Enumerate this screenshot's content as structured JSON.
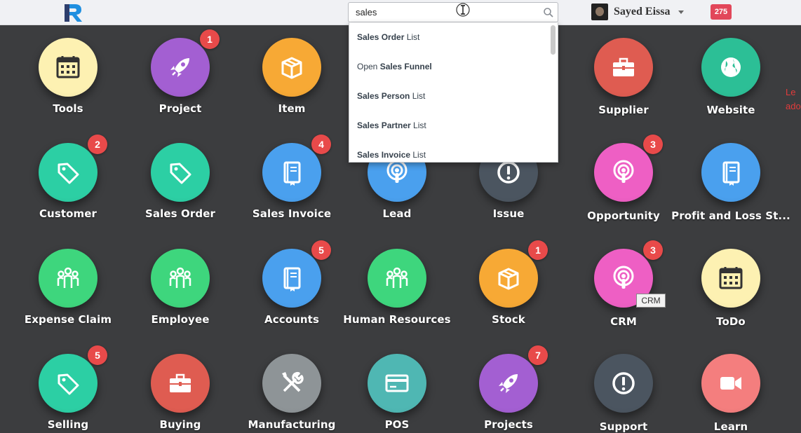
{
  "topbar": {
    "search_value": "sales",
    "user_name": "Sayed Eissa",
    "notification_count": "275"
  },
  "dropdown": [
    {
      "pre": "",
      "bold": "Sales Order",
      "post": " List"
    },
    {
      "pre": "Open ",
      "bold": "Sales Funnel",
      "post": ""
    },
    {
      "pre": "",
      "bold": "Sales Person",
      "post": " List"
    },
    {
      "pre": "",
      "bold": "Sales Partner",
      "post": " List"
    },
    {
      "pre": "",
      "bold": "Sales Invoice",
      "post": " List"
    }
  ],
  "tooltip": "CRM",
  "side_text": [
    "Le",
    "ado"
  ],
  "apps": [
    {
      "label": "Tools",
      "color": "#fdf1b2",
      "icon": "calendar",
      "badge": null
    },
    {
      "label": "Project",
      "color": "#a35fd2",
      "icon": "rocket",
      "badge": "1"
    },
    {
      "label": "Item",
      "color": "#f7a935",
      "icon": "box",
      "badge": null
    },
    {
      "label": "",
      "color": "",
      "icon": "",
      "badge": null
    },
    {
      "label": "",
      "color": "",
      "icon": "",
      "badge": null
    },
    {
      "label": "Supplier",
      "color": "#df5c51",
      "icon": "briefcase",
      "badge": null
    },
    {
      "label": "Website",
      "color": "#2cbf96",
      "icon": "globe",
      "badge": null
    },
    {
      "label": "Customer",
      "color": "#2ccfa4",
      "icon": "tag",
      "badge": "2"
    },
    {
      "label": "Sales Order",
      "color": "#2ccfa4",
      "icon": "tag",
      "badge": null
    },
    {
      "label": "Sales Invoice",
      "color": "#4aa0ee",
      "icon": "book",
      "badge": "4"
    },
    {
      "label": "Lead",
      "color": "#4aa0ee",
      "icon": "podcast",
      "badge": null
    },
    {
      "label": "Issue",
      "color": "#4b5560",
      "icon": "exclaim",
      "badge": null
    },
    {
      "label": "Opportunity",
      "color": "#ee5fc4",
      "icon": "podcast",
      "badge": "3"
    },
    {
      "label": "Profit and Loss St...",
      "color": "#4aa0ee",
      "icon": "book",
      "badge": null
    },
    {
      "label": "Expense Claim",
      "color": "#3ed67d",
      "icon": "people",
      "badge": null
    },
    {
      "label": "Employee",
      "color": "#3ed67d",
      "icon": "people",
      "badge": null
    },
    {
      "label": "Accounts",
      "color": "#4aa0ee",
      "icon": "book",
      "badge": "5"
    },
    {
      "label": "Human Resources",
      "color": "#3ed67d",
      "icon": "people",
      "badge": null
    },
    {
      "label": "Stock",
      "color": "#f7a935",
      "icon": "box",
      "badge": "1"
    },
    {
      "label": "CRM",
      "color": "#ee5fc4",
      "icon": "podcast",
      "badge": "3"
    },
    {
      "label": "ToDo",
      "color": "#fdf1b2",
      "icon": "calendar",
      "badge": null
    },
    {
      "label": "Selling",
      "color": "#2ccfa4",
      "icon": "tag",
      "badge": "5"
    },
    {
      "label": "Buying",
      "color": "#df5c51",
      "icon": "briefcase",
      "badge": null
    },
    {
      "label": "Manufacturing",
      "color": "#8e9497",
      "icon": "tools",
      "badge": null
    },
    {
      "label": "POS",
      "color": "#4fb7b3",
      "icon": "card",
      "badge": null
    },
    {
      "label": "Projects",
      "color": "#a35fd2",
      "icon": "rocket",
      "badge": "7"
    },
    {
      "label": "Support",
      "color": "#4b5560",
      "icon": "exclaim",
      "badge": null
    },
    {
      "label": "Learn",
      "color": "#f47e7e",
      "icon": "video",
      "badge": null
    }
  ]
}
